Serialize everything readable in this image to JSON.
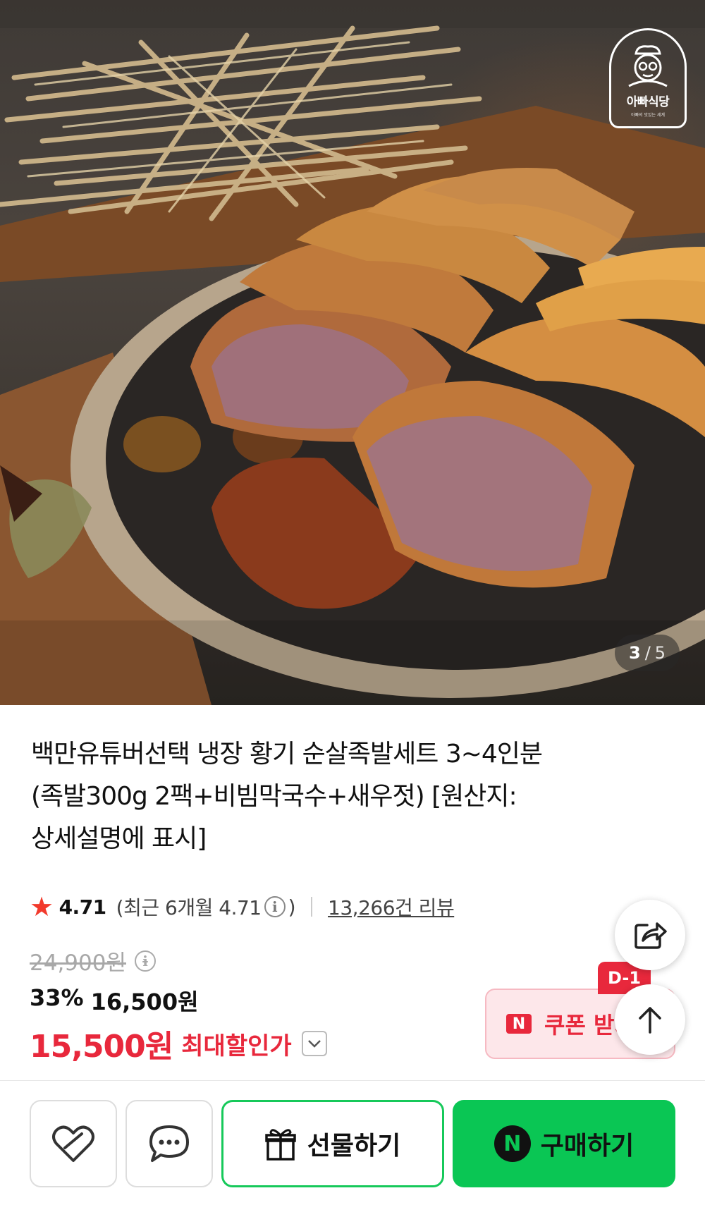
{
  "hero": {
    "brand_name": "아빠식당",
    "brand_sub": "아빠의 맛있는 세계",
    "page_current": "3",
    "page_separator": "/",
    "page_total": "5"
  },
  "product": {
    "title_line1": "백만유튜버선택 냉장 황기 순살족발세트 3~4인분",
    "title_line2": "(족발300g 2팩+비빔막국수+새우젓) [원산지:",
    "title_line3": "상세설명에 표시]"
  },
  "rating": {
    "score": "4.71",
    "recent_prefix": "(최근 6개월 4.71",
    "recent_suffix": ")",
    "reviews": "13,266건 리뷰"
  },
  "price": {
    "original": "24,900원",
    "discount_rate": "33%",
    "sale_price": "16,500원",
    "best_price": "15,500원",
    "best_label": "최대할인가"
  },
  "coupon": {
    "badge": "N",
    "label": "쿠폰 받기",
    "dday": "D-1"
  },
  "actions": {
    "gift_label": "선물하기",
    "buy_badge": "N",
    "buy_label": "구매하기"
  },
  "colors": {
    "accent_red": "#e8283c",
    "naver_green": "#0ac654",
    "star": "#f23a2c"
  }
}
